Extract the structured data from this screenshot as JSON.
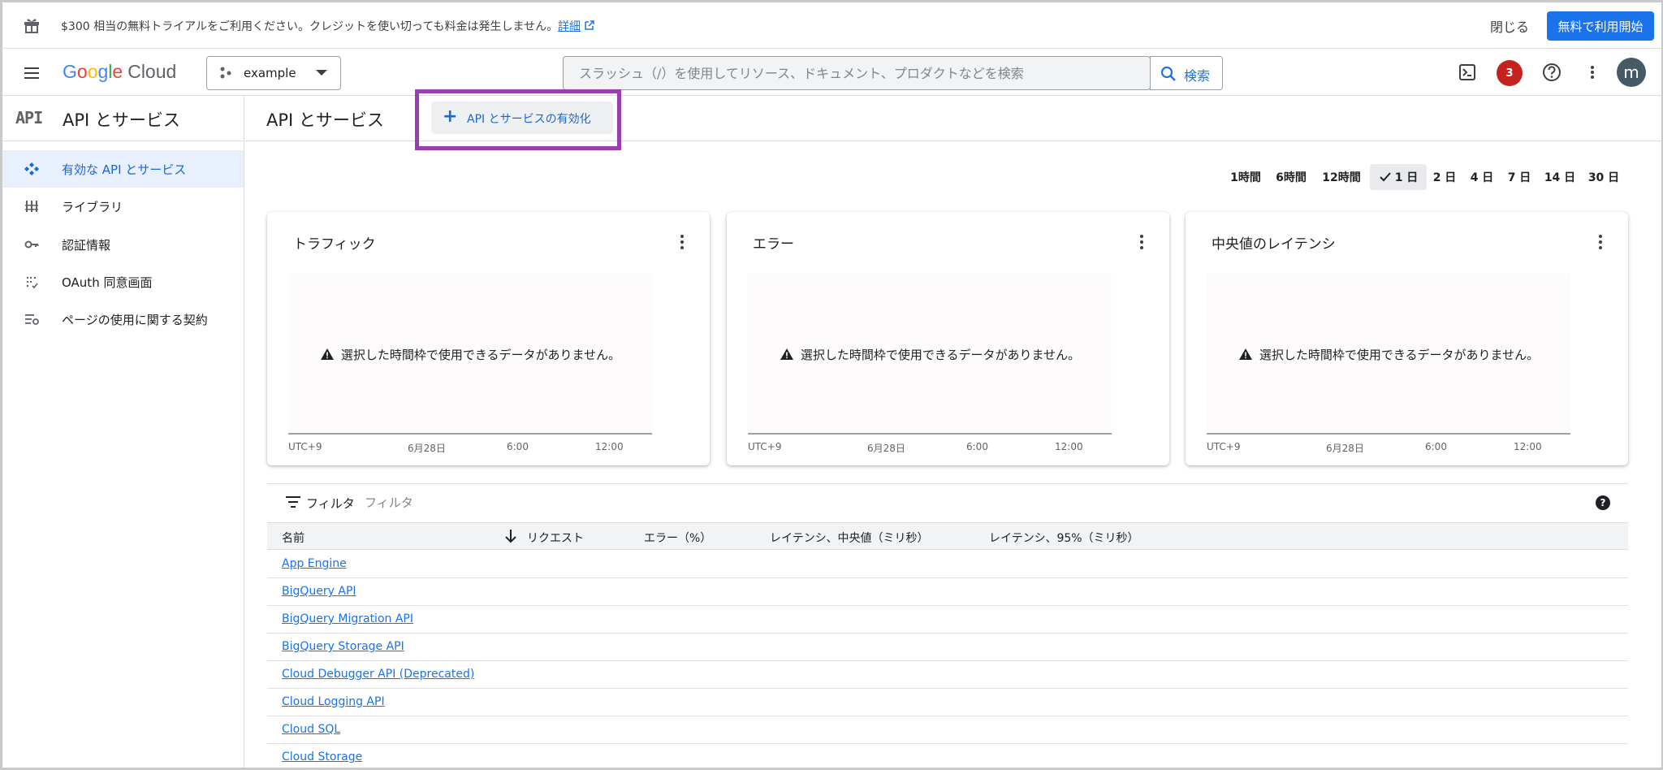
{
  "banner": {
    "message": "$300 相当の無料トライアルをご利用ください。クレジットを使い切っても料金は発生しません。",
    "detail_link": "詳細",
    "close_label": "閉じる",
    "start_button": "無料で利用開始"
  },
  "topbar": {
    "logo": {
      "G": "G",
      "o1": "o",
      "o2": "o",
      "g": "g",
      "l": "l",
      "e": "e",
      "cloud": "Cloud"
    },
    "project_name": "example",
    "search_placeholder": "スラッシュ（/）を使用してリソース、ドキュメント、プロダクトなどを検索",
    "search_button": "検索",
    "notification_count": "3",
    "avatar_initial": "m"
  },
  "sidebar": {
    "glyph": "API",
    "title": "API とサービス",
    "items": [
      {
        "label": "有効な API とサービス",
        "icon": "diamond-grid-icon",
        "active": true
      },
      {
        "label": "ライブラリ",
        "icon": "library-icon",
        "active": false
      },
      {
        "label": "認証情報",
        "icon": "key-icon",
        "active": false
      },
      {
        "label": "OAuth 同意画面",
        "icon": "consent-icon",
        "active": false
      },
      {
        "label": "ページの使用に関する契約",
        "icon": "settings-list-icon",
        "active": false
      }
    ]
  },
  "main": {
    "title": "API とサービス",
    "enable_button": "API とサービスの有効化",
    "time_ranges": [
      "1時間",
      "6時間",
      "12時間",
      "1 日",
      "2 日",
      "4 日",
      "7 日",
      "14 日",
      "30 日"
    ],
    "selected_range": "1 日",
    "cards": [
      {
        "title": "トラフィック",
        "no_data": "選択した時間枠で使用できるデータがありません。",
        "ticks": [
          "UTC+9",
          "6月28日",
          "6:00",
          "12:00"
        ]
      },
      {
        "title": "エラー",
        "no_data": "選択した時間枠で使用できるデータがありません。",
        "ticks": [
          "UTC+9",
          "6月28日",
          "6:00",
          "12:00"
        ]
      },
      {
        "title": "中央値のレイテンシ",
        "no_data": "選択した時間枠で使用できるデータがありません。",
        "ticks": [
          "UTC+9",
          "6月28日",
          "6:00",
          "12:00"
        ]
      }
    ],
    "filter": {
      "label": "フィルタ",
      "placeholder": "フィルタ",
      "help": "?"
    },
    "table": {
      "columns": [
        "名前",
        "リクエスト",
        "エラー（%）",
        "レイテンシ、中央値（ミリ秒）",
        "レイテンシ、95%（ミリ秒）"
      ],
      "rows": [
        "App Engine",
        "BigQuery API",
        "BigQuery Migration API",
        "BigQuery Storage API",
        "Cloud Debugger API (Deprecated)",
        "Cloud Logging API",
        "Cloud SQL",
        "Cloud Storage"
      ]
    }
  },
  "colors": {
    "accent": "#1a73e8",
    "highlight_border": "#9b3fb0",
    "notification": "#c5221f"
  }
}
